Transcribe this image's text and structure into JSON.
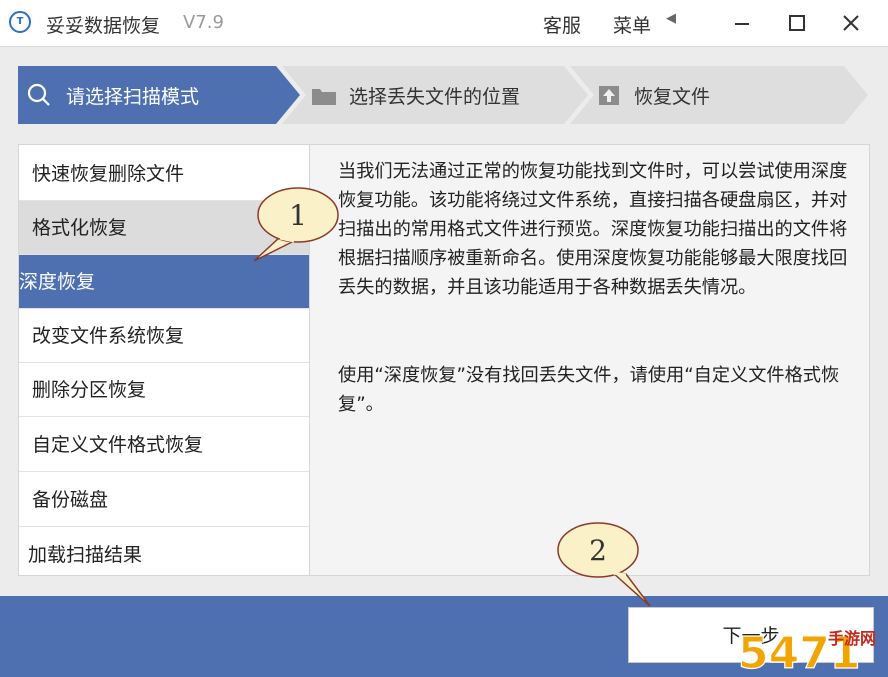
{
  "titlebar": {
    "logo_text": "T",
    "title": "妥妥数据恢复",
    "version": "V7.9",
    "support_label": "客服",
    "menu_label": "菜单",
    "menu_arrow": "◀",
    "minimize": "—",
    "maximize": "☐",
    "close": "✕"
  },
  "steps": [
    {
      "label": "请选择扫描模式",
      "icon": "search-icon",
      "active": true
    },
    {
      "label": "选择丢失文件的位置",
      "icon": "folder-icon",
      "active": false
    },
    {
      "label": "恢复文件",
      "icon": "upload-icon",
      "active": false
    }
  ],
  "modes": [
    {
      "label": "快速恢复删除文件"
    },
    {
      "label": "格式化恢复"
    },
    {
      "label": "深度恢复"
    },
    {
      "label": "改变文件系统恢复"
    },
    {
      "label": "删除分区恢复"
    },
    {
      "label": "自定义文件格式恢复"
    },
    {
      "label": "备份磁盘"
    },
    {
      "label": "加载扫描结果"
    }
  ],
  "description": {
    "paragraph1": "当我们无法通过正常的恢复功能找到文件时，可以尝试使用深度恢复功能。该功能将绕过文件系统，直接扫描各硬盘扇区，并对扫描出的常用格式文件进行预览。深度恢复功能扫描出的文件将根据扫描顺序被重新命名。使用深度恢复功能能够最大限度找回丢失的数据，并且该功能适用于各种数据丢失情况。",
    "paragraph2": "使用“深度恢复”没有找回丢失文件，请使用“自定义文件格式恢复”。"
  },
  "next_button": {
    "label": "下一步"
  },
  "callouts": [
    {
      "number": "1"
    },
    {
      "number": "2"
    }
  ],
  "watermark": {
    "text": "手游网",
    "brand": "5471"
  },
  "colors": {
    "accent": "#4f70b0",
    "step_inactive": "#dedede",
    "callout_fill": "#fbf1c9",
    "callout_border": "#8a3a2a"
  }
}
